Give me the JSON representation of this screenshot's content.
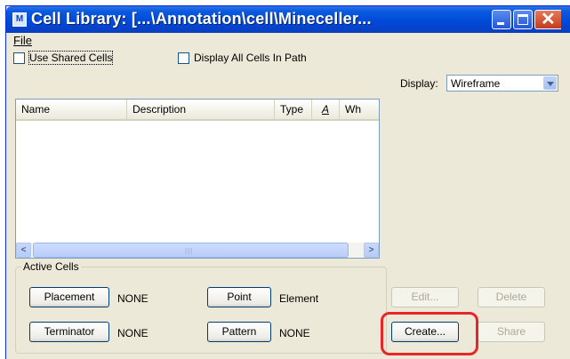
{
  "window": {
    "title": "Cell Library: [...\\Annotation\\cell\\Mineceller...",
    "icon": "app-icon",
    "controls": [
      "minimize-icon",
      "maximize-icon",
      "close-icon"
    ]
  },
  "menu": {
    "items": [
      {
        "label": "File"
      }
    ]
  },
  "options": {
    "use_shared_cells": {
      "label": "Use Shared Cells",
      "checked": false
    },
    "display_all_cells": {
      "label": "Display All Cells In Path",
      "checked": false
    }
  },
  "display": {
    "label": "Display:",
    "value": "Wireframe"
  },
  "list": {
    "columns": [
      "Name",
      "Description",
      "Type",
      "A",
      "Wh"
    ],
    "rows": []
  },
  "active_cells": {
    "title": "Active Cells",
    "placement": {
      "button": "Placement",
      "value": "NONE"
    },
    "terminator": {
      "button": "Terminator",
      "value": "NONE"
    },
    "point": {
      "button": "Point",
      "value": "Element"
    },
    "pattern": {
      "button": "Pattern",
      "value": "NONE"
    }
  },
  "actions": {
    "edit": "Edit...",
    "delete": "Delete",
    "create": "Create...",
    "share": "Share"
  },
  "colors": {
    "titlebar": "#0a5ae0",
    "highlight": "#e8262a"
  }
}
